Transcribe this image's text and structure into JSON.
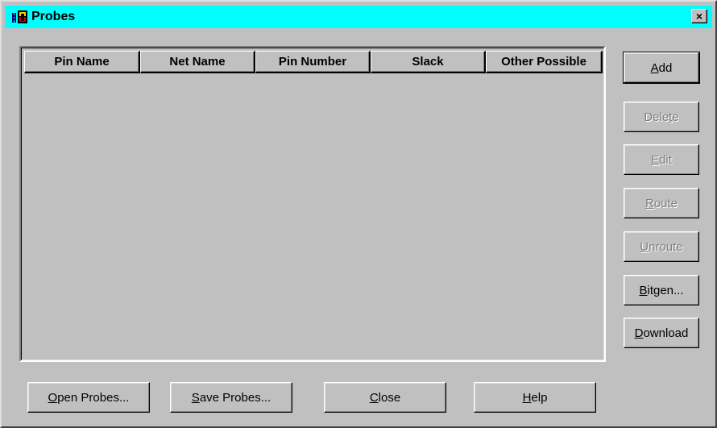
{
  "window": {
    "title": "Probes",
    "close_glyph": "×"
  },
  "table": {
    "columns": [
      "Pin Name",
      "Net Name",
      "Pin Number",
      "Slack",
      "Other Possible"
    ],
    "rows": []
  },
  "side_buttons": [
    {
      "label": "Add",
      "mnemonic_index": 0,
      "enabled": true,
      "default": true
    },
    {
      "label": "Delete",
      "mnemonic_index": 4,
      "enabled": false
    },
    {
      "label": "Edit",
      "mnemonic_index": 0,
      "enabled": false
    },
    {
      "label": "Route",
      "mnemonic_index": 0,
      "enabled": false
    },
    {
      "label": "Unroute",
      "mnemonic_index": 0,
      "enabled": false
    },
    {
      "label": "Bitgen...",
      "mnemonic_index": 0,
      "enabled": true
    },
    {
      "label": "Download",
      "mnemonic_index": 0,
      "enabled": true
    }
  ],
  "bottom_buttons": [
    {
      "label": "Open Probes...",
      "mnemonic_index": 0
    },
    {
      "label": "Save Probes...",
      "mnemonic_index": 0
    },
    {
      "label": "Close",
      "mnemonic_index": 0
    },
    {
      "label": "Help",
      "mnemonic_index": 0
    }
  ],
  "colors": {
    "titlebar": "#00ffff",
    "face": "#c0c0c0",
    "disabled_text": "#808080"
  },
  "icons": {
    "title_icon": "probes-app-icon",
    "close_icon": "close-icon"
  }
}
